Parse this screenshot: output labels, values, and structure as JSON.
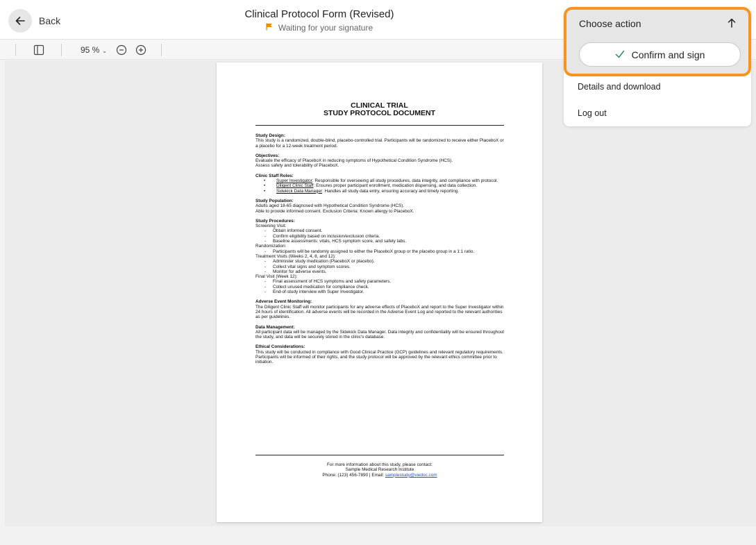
{
  "header": {
    "back_label": "Back",
    "title": "Clinical Protocol Form (Revised)",
    "status": "Waiting for your signature"
  },
  "toolbar": {
    "zoom": "95 %"
  },
  "menu": {
    "title": "Choose action",
    "confirm_label": "Confirm and sign",
    "items": [
      "Details and download",
      "Log out"
    ]
  },
  "colors": {
    "accent_orange": "#f7941d",
    "status_flag": "#f28b00",
    "check_green": "#2e8b57"
  },
  "document": {
    "title_line1": "CLINICAL TRIAL",
    "title_line2": "STUDY PROTOCOL DOCUMENT",
    "study_design": {
      "heading": "Study Design:",
      "text": "This study is a randomized, double-blind, placebo-controlled trial. Participants will be randomized to receive either PlaceboX or a placebo for a 12-week treatment period."
    },
    "objectives": {
      "heading": "Objectives:",
      "line1": "Evaluate the efficacy of PlaceboX in reducing symptoms of Hypothetical Condition Syndrome (HCS).",
      "line2": "Assess safety and tolerability of PlaceboX."
    },
    "staff": {
      "heading": "Clinic Staff Roles:",
      "roles": [
        {
          "name": "Super Investigator",
          "desc": ": Responsible for overseeing all study procedures, data integrity, and compliance with protocol."
        },
        {
          "name": "Diligent Clinic Staff",
          "desc": ": Ensures proper participant enrollment, medication dispensing, and data collection."
        },
        {
          "name": "Sidekick Data Manager",
          "desc": ": Handles all study data entry, ensuring accuracy and timely reporting."
        }
      ]
    },
    "population": {
      "heading": "Study Population:",
      "line1": "Adults aged 18-65 diagnosed with Hypothetical Condition Syndrome (HCS).",
      "line2": "Able to provide informed consent. Exclusion Criteria: Known allergy to PlaceboX."
    },
    "procedures": {
      "heading": "Study Procedures:",
      "screening": "Screening Visit:",
      "screening_items": [
        "Obtain informed consent.",
        "Confirm eligibility based on inclusion/exclusion criteria.",
        "Baseline assessments: vitals, HCS symptom score, and safety labs."
      ],
      "randomization": "Randomization:",
      "randomization_items": [
        "Participants will be randomly assigned to either the PlaceboX group or the placebo group in a 1:1 ratio."
      ],
      "treatment": "Treatment Visits (Weeks 2, 4, 8, and 12):",
      "treatment_items": [
        "Administer study medication (PlaceboX or placebo).",
        "Collect vital signs and symptom scores.",
        "Monitor for adverse events."
      ],
      "final": "Final Visit (Week 12):",
      "final_items": [
        "Final assessment of HCS symptoms and safety parameters.",
        "Collect unused medication for compliance check.",
        "End-of-study interview with Super Investigator."
      ]
    },
    "adverse": {
      "heading": "Adverse Event Monitoring:",
      "text": "The Diligent Clinic Staff will monitor participants for any adverse effects of PlaceboX and report to the Super Investigator within 24 hours of identification. All adverse events will be recorded in the Adverse Event Log and reported to the relevant authorities as per guidelines."
    },
    "data_mgmt": {
      "heading": "Data Management:",
      "text": "All participant data will be managed by the Sidekick Data Manager. Data integrity and confidentiality will be ensured throughout the study, and data will be securely stored in the clinic's database."
    },
    "ethics": {
      "heading": "Ethical Considerations:",
      "text": "This study will be conducted in compliance with Good Clinical Practice (GCP) guidelines and relevant regulatory requirements. Participants will be informed of their rights, and the study protocol will be approved by the relevant ethics committee prior to initiation."
    },
    "contact": {
      "line1": "For more information about this study, please contact:",
      "line2": "Sample Medical Research Institute",
      "phone": "Phone: (123) 456-7890 | Email: ",
      "email": "samplestudy@viedoc.com"
    }
  }
}
